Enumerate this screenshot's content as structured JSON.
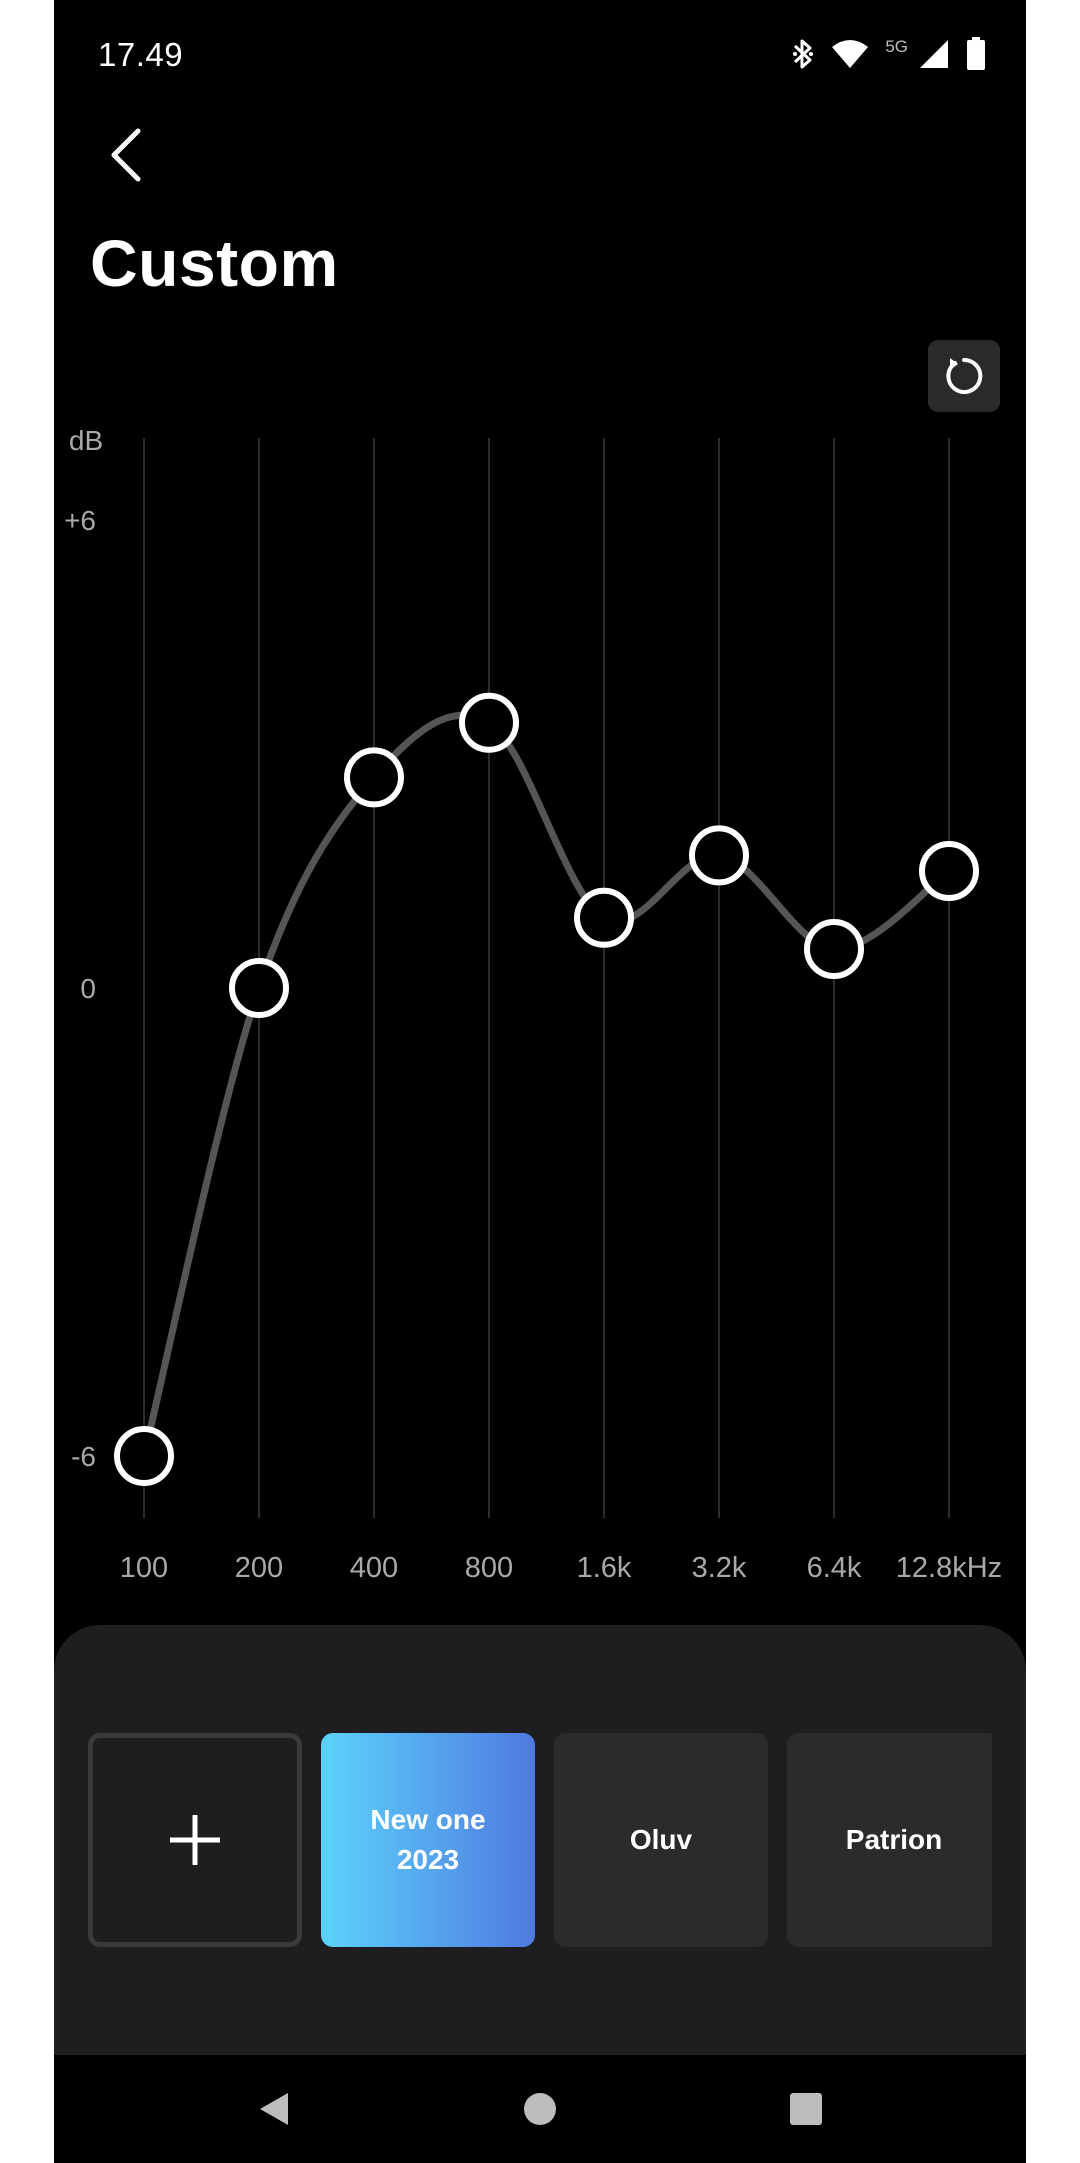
{
  "status_bar": {
    "time": "17.49",
    "network_label": "5G",
    "icons": [
      "bluetooth-icon",
      "wifi-icon",
      "signal-icon",
      "battery-icon"
    ]
  },
  "header": {
    "back_icon": "chevron-left-icon",
    "title": "Custom",
    "reset_icon": "refresh-icon"
  },
  "chart_data": {
    "type": "line",
    "ylabel": "dB",
    "y_ticks": [
      "+6",
      "0",
      "-6"
    ],
    "ylim": [
      -6,
      6
    ],
    "categories": [
      "100",
      "200",
      "400",
      "800",
      "1.6k",
      "3.2k",
      "6.4k",
      "12.8kHz"
    ],
    "values": [
      -6,
      0,
      2.7,
      3.4,
      0.9,
      1.7,
      0.5,
      1.5
    ],
    "grid": "vertical",
    "colors": {
      "line": "#555555",
      "handle_stroke": "#ffffff",
      "handle_fill": "#000000",
      "grid": "#2c2c2c",
      "label": "#a9a9a9"
    }
  },
  "presets": {
    "add_icon": "plus-icon",
    "items": [
      {
        "label": "New one\n2023",
        "active": true
      },
      {
        "label": "Oluv",
        "active": false
      },
      {
        "label": "Patrion",
        "active": false
      }
    ]
  },
  "nav_bar": {
    "icons": [
      "back-triangle-icon",
      "home-circle-icon",
      "recents-square-icon"
    ]
  },
  "colors": {
    "background": "#000000",
    "panel": "#1e1e20",
    "preset_tile": "#2b2b2d",
    "active_gradient_start": "#5cd2fb",
    "active_gradient_end": "#4f7ae0"
  }
}
